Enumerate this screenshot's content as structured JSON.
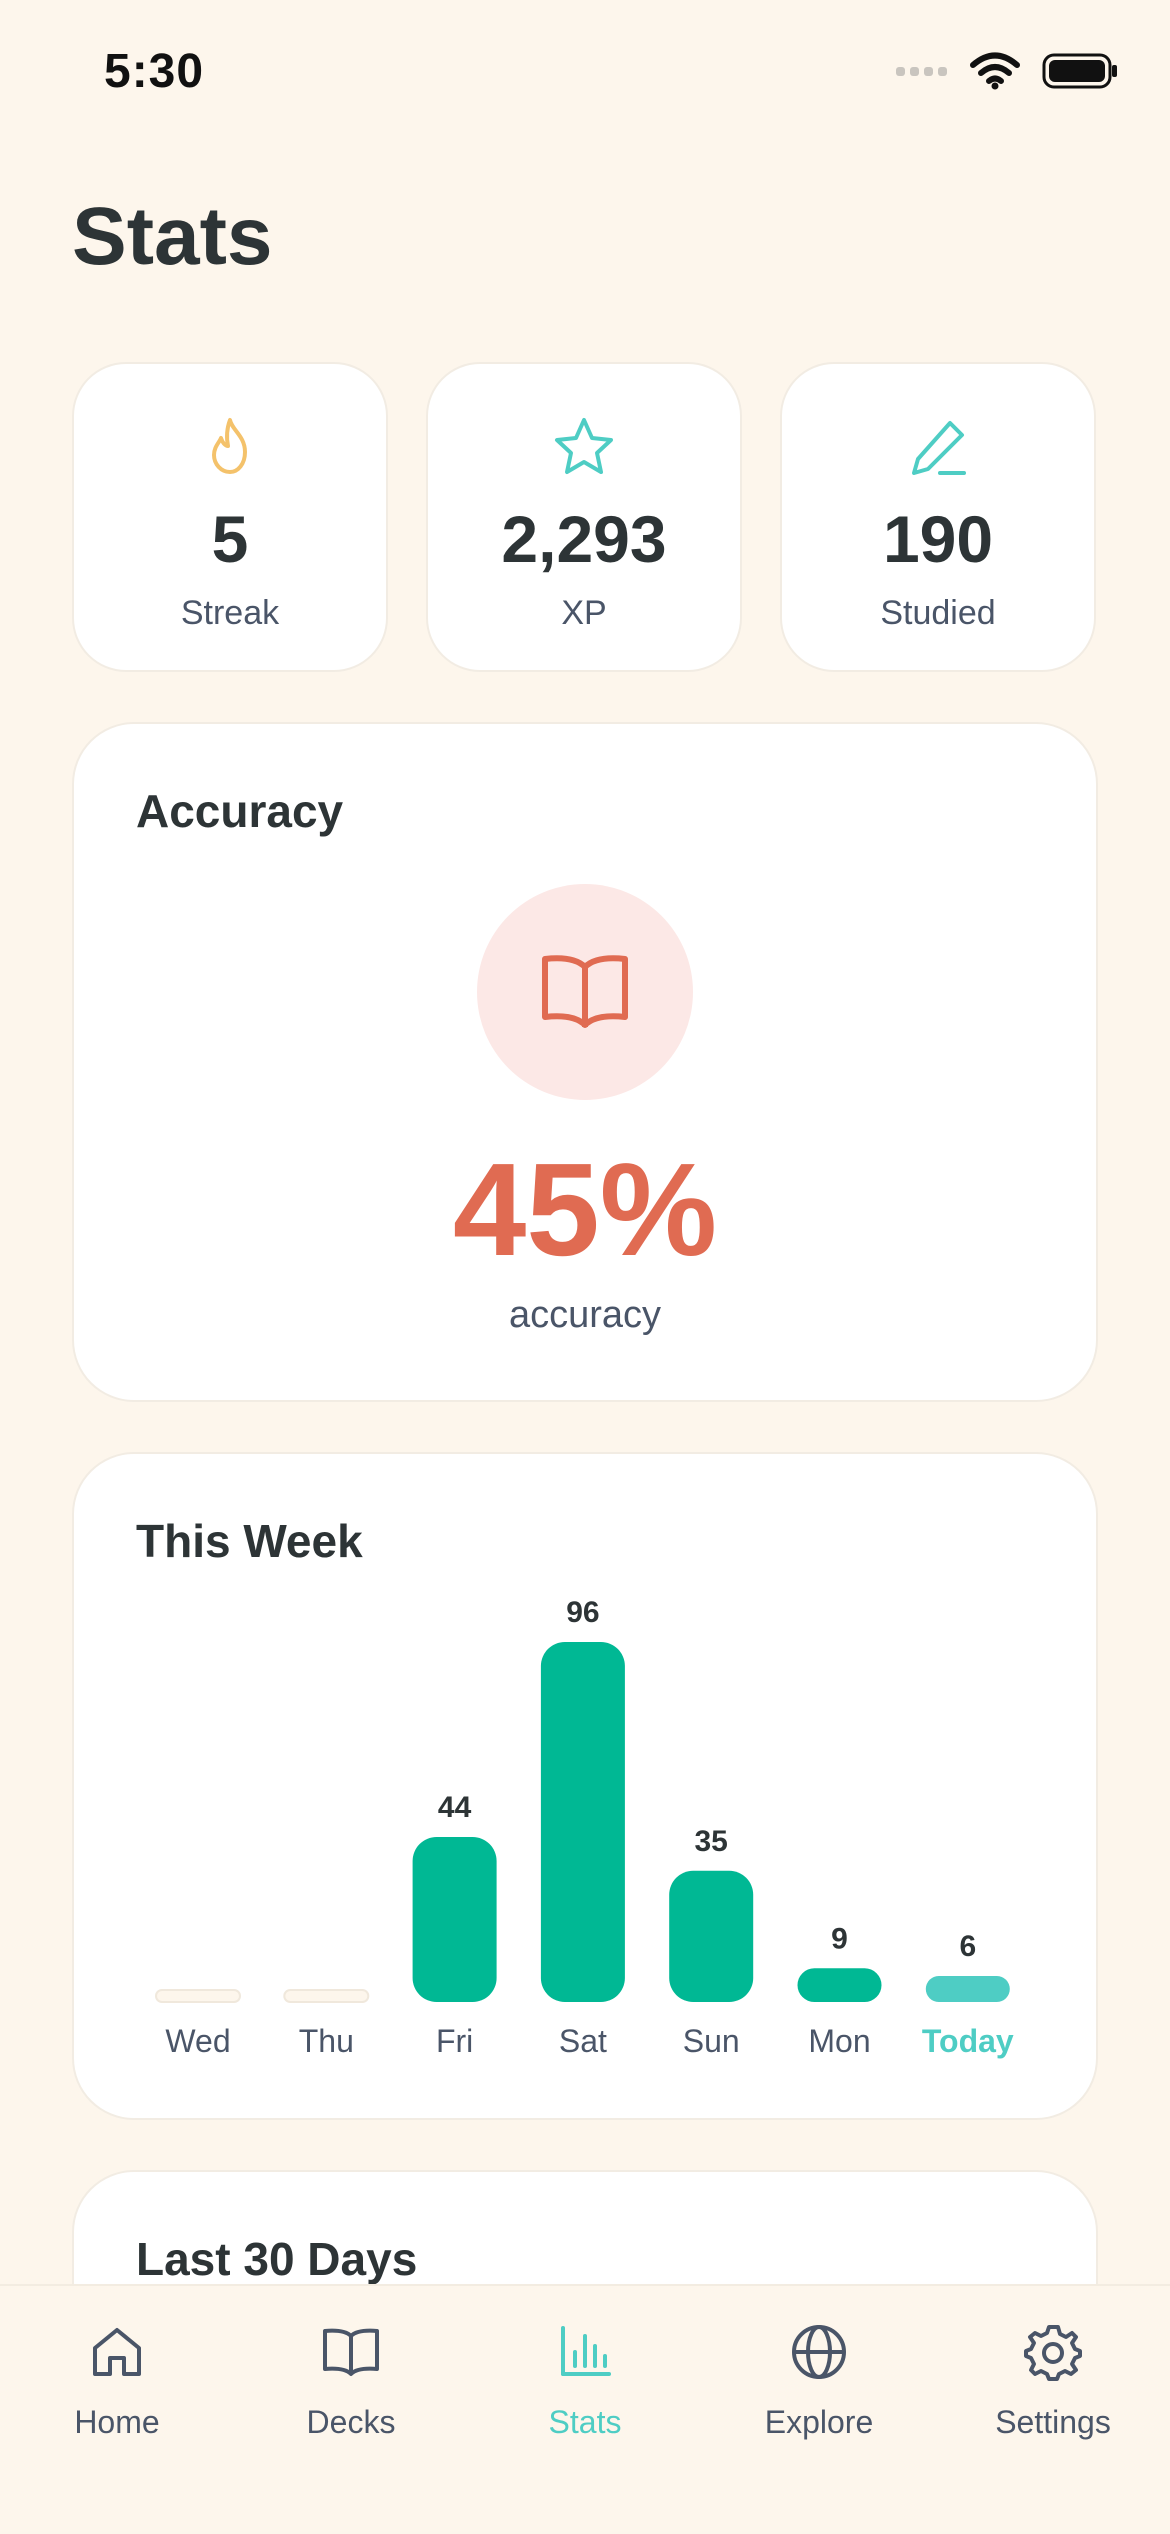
{
  "status_bar": {
    "time": "5:30"
  },
  "page": {
    "title": "Stats"
  },
  "stats": [
    {
      "value": "5",
      "label": "Streak",
      "icon": "flame-icon",
      "color": "#F4C26B"
    },
    {
      "value": "2,293",
      "label": "XP",
      "icon": "star-icon",
      "color": "#4ECDC4"
    },
    {
      "value": "190",
      "label": "Studied",
      "icon": "pencil-icon",
      "color": "#4ECDC4"
    }
  ],
  "accuracy": {
    "title": "Accuracy",
    "value": "45%",
    "label": "accuracy",
    "icon": "book-icon",
    "color": "#E06B52"
  },
  "week": {
    "title": "This Week",
    "chart_data": {
      "type": "bar",
      "categories": [
        "Wed",
        "Thu",
        "Fri",
        "Sat",
        "Sun",
        "Mon",
        "Today"
      ],
      "values": [
        0,
        0,
        44,
        96,
        35,
        9,
        6
      ],
      "data_labels": [
        "",
        "",
        "44",
        "96",
        "35",
        "9",
        "6"
      ],
      "highlight": "Today",
      "bar_color": "#00B894",
      "highlight_color": "#4ECDC4"
    }
  },
  "last30": {
    "title": "Last 30 Days"
  },
  "tabs": [
    {
      "label": "Home",
      "icon": "home-icon",
      "active": false
    },
    {
      "label": "Decks",
      "icon": "book-icon",
      "active": false
    },
    {
      "label": "Stats",
      "icon": "bar-chart-icon",
      "active": true
    },
    {
      "label": "Explore",
      "icon": "globe-icon",
      "active": false
    },
    {
      "label": "Settings",
      "icon": "gear-icon",
      "active": false
    }
  ]
}
